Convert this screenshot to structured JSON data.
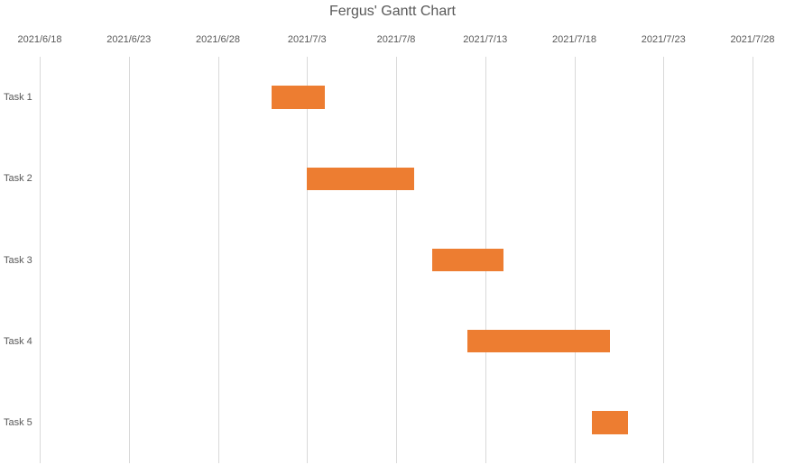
{
  "chart_data": {
    "type": "bar",
    "orientation": "horizontal",
    "subtype": "gantt",
    "title": "Fergus' Gantt Chart",
    "x_axis": {
      "type": "date",
      "ticks": [
        "2021/6/18",
        "2021/6/23",
        "2021/6/28",
        "2021/7/3",
        "2021/7/8",
        "2021/7/13",
        "2021/7/18",
        "2021/7/23",
        "2021/7/28"
      ],
      "min": "2021/6/18",
      "max": "2021/7/28"
    },
    "categories": [
      "Task 1",
      "Task 2",
      "Task 3",
      "Task 4",
      "Task 5"
    ],
    "tasks": [
      {
        "name": "Task 1",
        "start": "2021/7/1",
        "end": "2021/7/4",
        "duration_days": 3
      },
      {
        "name": "Task 2",
        "start": "2021/7/3",
        "end": "2021/7/9",
        "duration_days": 6
      },
      {
        "name": "Task 3",
        "start": "2021/7/10",
        "end": "2021/7/14",
        "duration_days": 4
      },
      {
        "name": "Task 4",
        "start": "2021/7/12",
        "end": "2021/7/20",
        "duration_days": 8
      },
      {
        "name": "Task 5",
        "start": "2021/7/19",
        "end": "2021/7/21",
        "duration_days": 2
      }
    ],
    "bar_color": "#ed7d31",
    "xlabel": "",
    "ylabel": ""
  }
}
